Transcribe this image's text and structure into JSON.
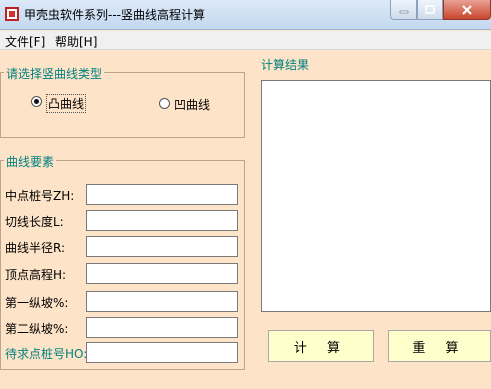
{
  "window": {
    "title": "甲壳虫软件系列---竖曲线高程计算"
  },
  "menu": {
    "file": "文件[F]",
    "help": "帮助[H]"
  },
  "curve_type": {
    "legend": "请选择竖曲线类型",
    "convex_label": "凸曲线",
    "concave_label": "凹曲线",
    "selected": "凸曲线"
  },
  "elements": {
    "legend": "曲线要素",
    "fields": [
      {
        "label": "中点桩号ZH:",
        "value": ""
      },
      {
        "label": "切线长度L:",
        "value": ""
      },
      {
        "label": "曲线半径R:",
        "value": ""
      },
      {
        "label": "顶点高程H:",
        "value": ""
      },
      {
        "label": "第一纵坡%:",
        "value": ""
      },
      {
        "label": "第二纵坡%:",
        "value": ""
      },
      {
        "label": "待求点桩号HO:",
        "value": ""
      }
    ]
  },
  "result": {
    "label": "计算结果",
    "text": ""
  },
  "buttons": {
    "calculate": "计 算",
    "reset": "重 算"
  },
  "colors": {
    "background": "#fde3c8",
    "label_teal": "#008080",
    "button_bg": "#ffffcc"
  }
}
